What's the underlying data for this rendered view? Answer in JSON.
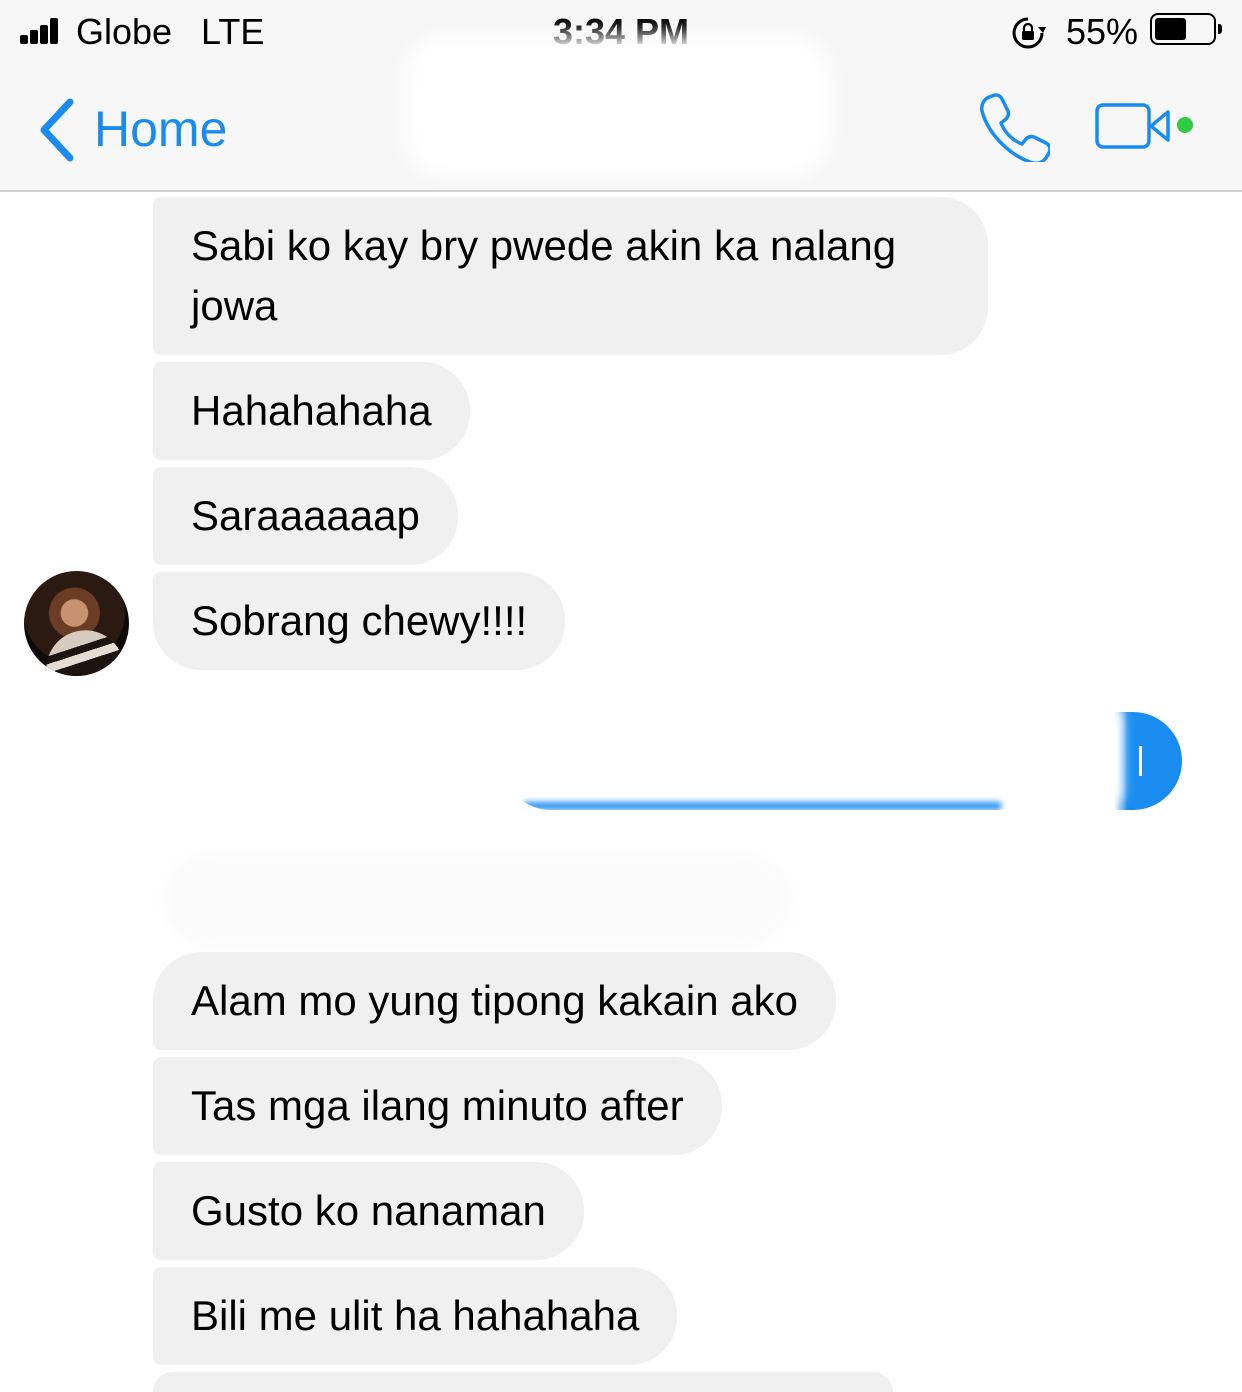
{
  "status_bar": {
    "carrier": "Globe",
    "network": "LTE",
    "time": "3:34 PM",
    "battery_percent": "55%",
    "battery_level": 0.55
  },
  "nav": {
    "back_label": "Home",
    "icons": [
      "chevron-left-icon",
      "phone-icon",
      "video-camera-icon"
    ],
    "accent_color": "#1a8cf0",
    "active_dot_color": "#2ecc40"
  },
  "messages": {
    "m1": "Sabi ko kay bry pwede akin ka nalang jowa",
    "m2": "Hahahahaha",
    "m3": "Saraaaaaap",
    "m4": "Sobrang chewy!!!!",
    "m5": "Alam mo yung tipong kakain ako",
    "m6": "Tas mga ilang minuto after",
    "m7": "Gusto ko nanaman",
    "m8": "Bili me ulit ha hahahaha"
  },
  "colors": {
    "received_bubble": "#f0f0f0",
    "sent_bubble": "#1a8cf0"
  }
}
